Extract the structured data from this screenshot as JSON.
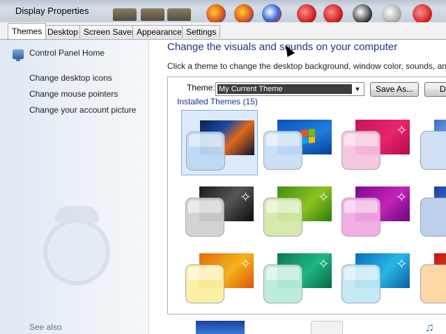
{
  "window": {
    "title": "Display Properties"
  },
  "tabs": [
    {
      "label": "Themes",
      "active": true
    },
    {
      "label": "Desktop",
      "active": false
    },
    {
      "label": "Screen Saver",
      "active": false
    },
    {
      "label": "Appearance",
      "active": false
    },
    {
      "label": "Settings",
      "active": false
    }
  ],
  "sidebar": {
    "home_link": "Control Panel Home",
    "links": [
      "Change desktop icons",
      "Change mouse pointers",
      "Change your account picture"
    ],
    "see_also": "See also",
    "home_icon": "control-panel-icon"
  },
  "main": {
    "title": "Change the visuals and sounds on your computer",
    "description": "Click a theme to change the desktop background, window color, sounds, and",
    "theme_label": "Theme:",
    "theme_value": "My Current Theme",
    "save_as_label": "Save As...",
    "delete_label": "D",
    "installed_label": "Installed Themes (15)"
  },
  "themes": [
    {
      "glass": "#bcd8f5",
      "wall": "linear-gradient(135deg,#0b1f4a 0%,#1c4aa0 35%,#e06a1a 60%,#0a1430 100%)",
      "selected": true,
      "style": "photo"
    },
    {
      "glass": "#c6dff5",
      "wall": "linear-gradient(160deg,#0a4fb7 0%,#1f7fe0 50%,#0a3f9c 100%)",
      "selected": false,
      "style": "windows"
    },
    {
      "glass": "#f6c2dc",
      "wall": "linear-gradient(135deg,#c8145a 0%,#e8246c 55%,#b30b4c 100%)",
      "selected": false,
      "style": "flare"
    },
    {
      "glass": "#d0d0d0",
      "wall": "linear-gradient(135deg,#1a1a1a 0%,#555555 50%,#0d0d0d 100%)",
      "selected": false,
      "style": "flare"
    },
    {
      "glass": "#d3e9a6",
      "wall": "linear-gradient(135deg,#3f8f12 0%,#8cc21e 55%,#2f7a0a 100%)",
      "selected": false,
      "style": "flare"
    },
    {
      "glass": "#f2a7e2",
      "wall": "linear-gradient(135deg,#7d0a8a 0%,#c222b8 55%,#6a067a 100%)",
      "selected": false,
      "style": "flare"
    },
    {
      "glass": "#fbefa0",
      "wall": "linear-gradient(135deg,#e46b0a 0%,#f7b11a 55%,#d9580a 100%)",
      "selected": false,
      "style": "flare"
    },
    {
      "glass": "#b8ecd8",
      "wall": "linear-gradient(135deg,#0a7a52 0%,#1fb585 55%,#066a46 100%)",
      "selected": false,
      "style": "flare"
    },
    {
      "glass": "#bfe8f4",
      "wall": "linear-gradient(135deg,#0a6fb8 0%,#27b6e6 55%,#0a5fa0 100%)",
      "selected": false,
      "style": "flare"
    }
  ]
}
